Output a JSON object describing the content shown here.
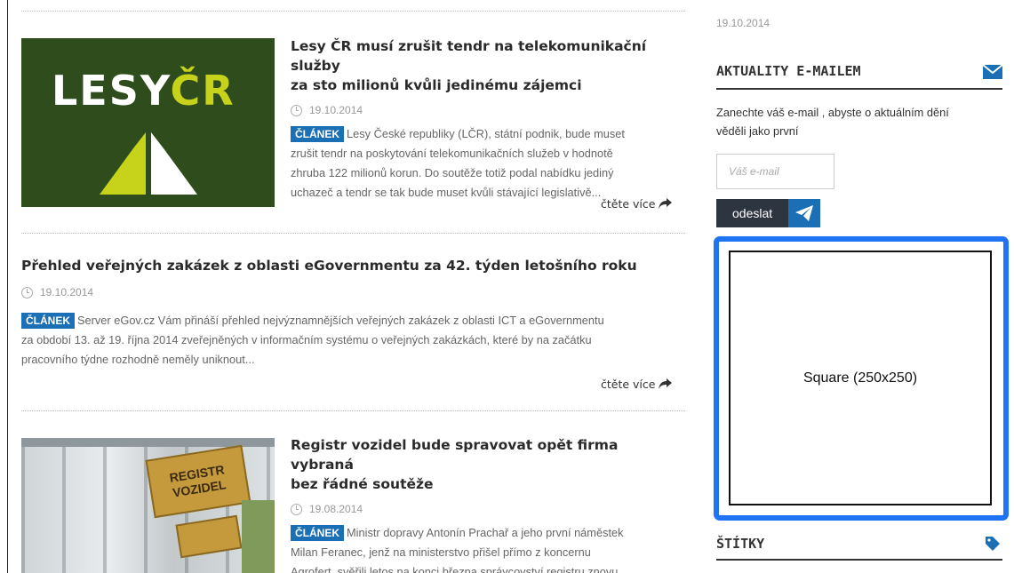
{
  "articles": [
    {
      "title_line1": "Lesy ČR musí zrušit tendr na telekomunikační služby",
      "title_line2": "za sto milionů kvůli jedinému zájemci",
      "date": "19.10.2014",
      "badge": "ČLÁNEK",
      "perex_line1": "Lesy České republiky (LČR), státní podnik, bude muset",
      "perex_line2": "zrušit tendr na poskytování telekomunikačních služeb v hodnotě",
      "perex_line3": "zhruba 122 milionů korun. Do soutěže totiž podal nabídku jediný",
      "perex_line4": "uchazeč a tendr se tak bude muset kvůli stávající legislativě...",
      "more": "čtěte více",
      "logo_text_1": "LESY",
      "logo_text_2": "ČR"
    },
    {
      "title": "Přehled veřejných zakázek z oblasti eGovernmentu za 42. týden letošního roku",
      "date": "19.10.2014",
      "badge": "ČLÁNEK",
      "perex_line1": "Server eGov.cz Vám přináší přehled nejvýznamnějších veřejných zakázek z oblasti ICT a eGovernmentu",
      "perex_line2": "za období 13. až 19. října 2014 zveřejněných v informačním systému o veřejných zakázkách, které by na začátku",
      "perex_line3": "pracovního týdne rozhodně neměly uniknout...",
      "more": "čtěte více"
    },
    {
      "title_line1": "Registr vozidel bude spravovat opět firma vybraná",
      "title_line2": "bez řádné soutěže",
      "date": "19.08.2014",
      "badge": "ČLÁNEK",
      "perex_line1": "Ministr dopravy Antonín Prachař a jeho první náměstek",
      "perex_line2": "Milan Feranec, jenž na ministerstvo přišel přímo z koncernu",
      "perex_line3": "Agrofert, svěřili letos na konci března správcovství registru znovu",
      "sign_line1": "REGISTR",
      "sign_line2": "VOZIDEL"
    }
  ],
  "sidebar": {
    "top_date": "19.10.2014",
    "newsletter": {
      "heading": "AKTUALITY E-MAILEM",
      "description_line1": "Zanechte váš e-mail , abyste o aktuálním dění",
      "description_line2": "věděli jako první",
      "email_placeholder": "Váš e-mail",
      "submit_label": "odeslat"
    },
    "ad_label": "Square (250x250)",
    "tags_heading": "ŠTÍTKY"
  },
  "colors": {
    "accent_blue": "#1a6fb5",
    "ad_border": "#1e74f4",
    "logo_green": "#2f4d1c",
    "logo_yellow": "#c7d31b"
  }
}
